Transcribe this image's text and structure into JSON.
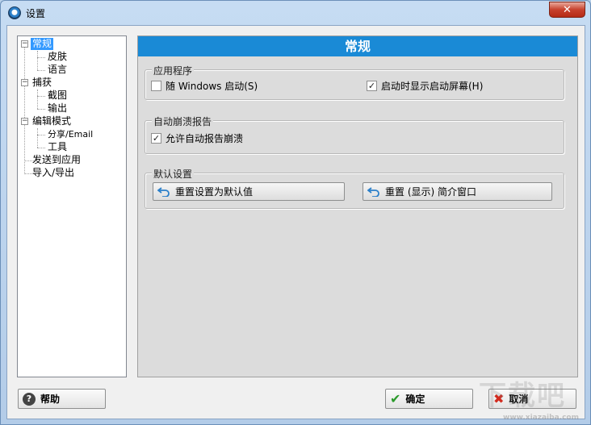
{
  "window": {
    "title": "设置",
    "close_glyph": "✕"
  },
  "tree": {
    "items": [
      {
        "label": "常规"
      },
      {
        "label": "皮肤"
      },
      {
        "label": "语言"
      },
      {
        "label": "捕获"
      },
      {
        "label": "截图"
      },
      {
        "label": "输出"
      },
      {
        "label": "编辑模式"
      },
      {
        "label": "分享/Email"
      },
      {
        "label": "工具"
      },
      {
        "label": "发送到应用"
      },
      {
        "label": "导入/导出"
      }
    ],
    "selected": "常规"
  },
  "panel": {
    "header": "常规",
    "groups": {
      "app": {
        "label": "应用程序",
        "startup_with_windows": {
          "label": "随 Windows 启动(S)",
          "checked": false
        },
        "show_splash": {
          "label": "启动时显示启动屏幕(H)",
          "checked": true
        }
      },
      "crash": {
        "label": "自动崩溃报告",
        "allow_crash_report": {
          "label": "允许自动报告崩溃",
          "checked": true
        }
      },
      "defaults": {
        "label": "默认设置",
        "reset_defaults": "重置设置为默认值",
        "reset_intro": "重置 (显示) 简介窗口"
      }
    }
  },
  "footer": {
    "help": "帮助",
    "ok": "确定",
    "cancel": "取消"
  },
  "checkmark_glyph": "✓",
  "watermark": {
    "main": "下载吧",
    "sub": "www.xiazaiba.com"
  },
  "colors": {
    "header_blue": "#1a8ad6",
    "selected_blue": "#3399ff",
    "ok_green": "#2b9b2b",
    "cancel_red": "#d22b1f"
  }
}
